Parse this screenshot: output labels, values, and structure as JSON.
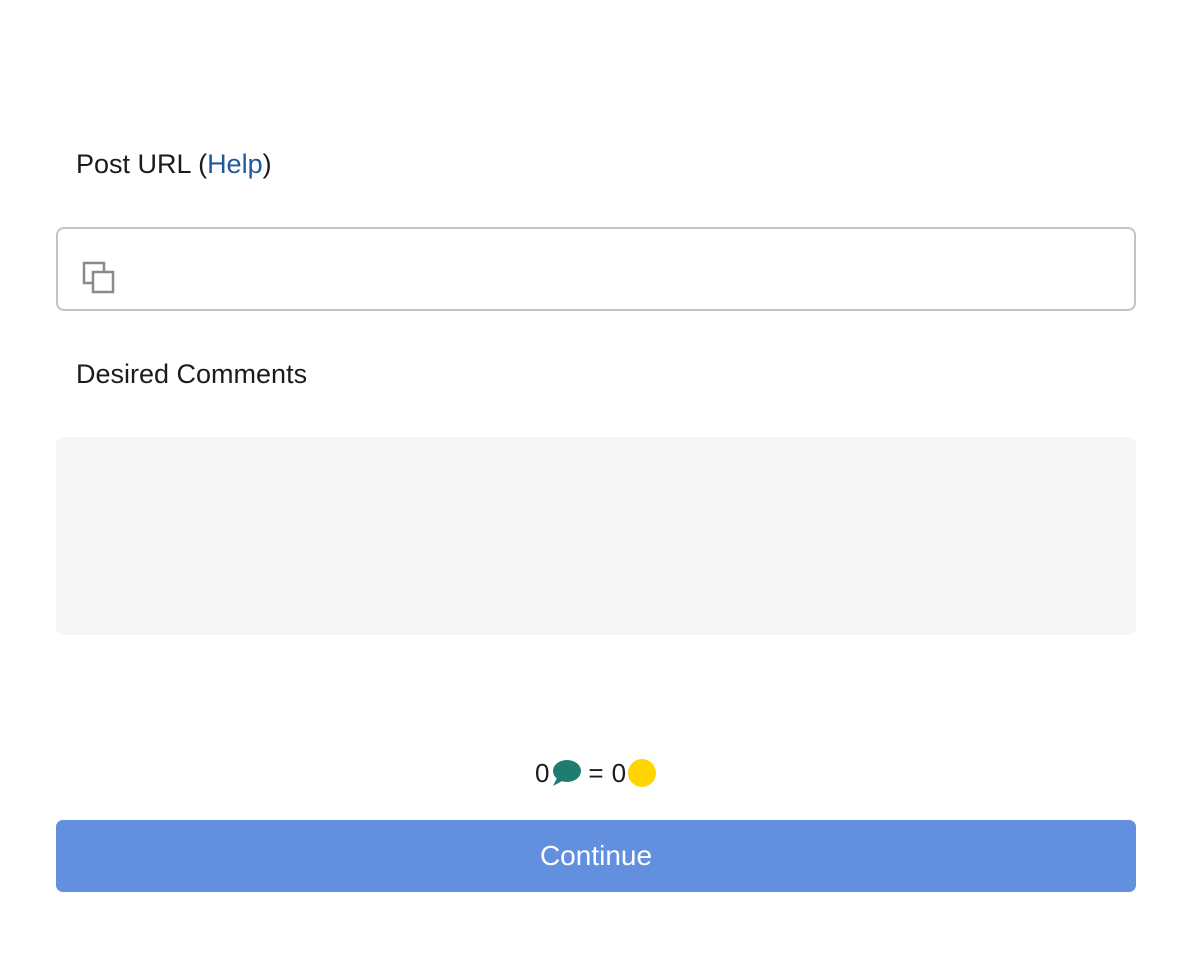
{
  "post_url": {
    "label": "Post URL",
    "paren_open": "(",
    "help_link": "Help",
    "paren_close": ")",
    "value": "",
    "placeholder": "",
    "icon": "paste-icon"
  },
  "desired_comments": {
    "label": "Desired Comments",
    "value": ""
  },
  "cost": {
    "comments_count": "0",
    "comment_icon": "comment-bubble-icon",
    "equals": "=",
    "coins_count": "0",
    "coin_icon": "coin-icon",
    "comment_color": "#1e7c70",
    "coin_color": "#ffd500"
  },
  "continue_button": {
    "label": "Continue",
    "color": "#6390de"
  }
}
